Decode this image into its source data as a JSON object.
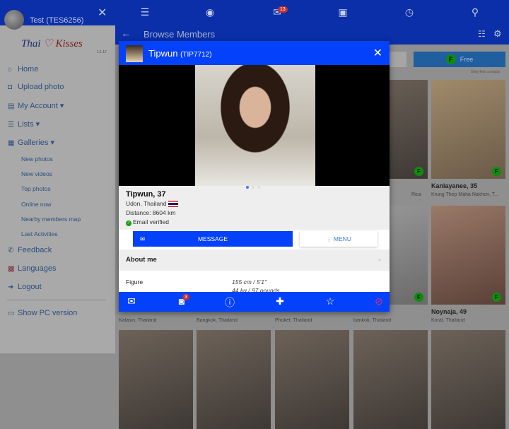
{
  "topbar": {
    "messages_badge": "13",
    "icons": [
      "menu-icon",
      "user-circle-icon",
      "envelope-icon",
      "contact-card-icon",
      "clock-icon",
      "search-icon"
    ]
  },
  "subbar": {
    "title": "Browse Members"
  },
  "sidebar": {
    "user": "Test (TES6256)",
    "logo": {
      "left": "Thai",
      "right": "Kisses"
    },
    "version": "1.1.17",
    "items": [
      {
        "label": "Home",
        "icon": "⌂"
      },
      {
        "label": "Upload photo",
        "icon": "◘"
      },
      {
        "label": "My Account ▾",
        "icon": "▤"
      },
      {
        "label": "Lists ▾",
        "icon": "☰"
      },
      {
        "label": "Galleries ▾",
        "icon": "▦"
      }
    ],
    "gallery_items": [
      "New photos",
      "New videos",
      "Top photos",
      "Online now",
      "Nearby members map",
      "Last Activities"
    ],
    "bottom_items": [
      {
        "label": "Feedback",
        "icon": "✆"
      },
      {
        "label": "Languages",
        "icon": "▩"
      },
      {
        "label": "Logout",
        "icon": "➜"
      },
      {
        "label": "Show PC version",
        "icon": "▭"
      }
    ]
  },
  "filter": {
    "free_label": "Free",
    "free_badge": "F",
    "daily_note": "Daily free contacts"
  },
  "cards": [
    {
      "name": "",
      "location": "Rica"
    },
    {
      "name": "Kanlayanee, 35",
      "location": "Krung Thep Maha Nakhon, T..."
    },
    {
      "name": "",
      "location": "Kalasin, Thailand"
    },
    {
      "name": "",
      "location": "Bangkok, Thailand"
    },
    {
      "name": "",
      "location": "Phuket, Thailand"
    },
    {
      "name": "",
      "location": "bankok, Thailand"
    },
    {
      "name": "Noynaja, 49",
      "location": "Korat, Thailand"
    }
  ],
  "modal": {
    "name": "Tipwun",
    "id": "(TIP7712)",
    "headline": "Tipwun, 37",
    "location": "Udon, Thailand",
    "distance": "Distance: 8604 km",
    "verified": "Email verified",
    "message_label": "MESSAGE",
    "menu_label": "⋮ MENU",
    "about_label": "About me",
    "figure_label": "Figure",
    "figure_height": "155 cm / 5'1\"",
    "figure_weight": "44 kg / 97 pounds",
    "photo_badge": "3"
  }
}
